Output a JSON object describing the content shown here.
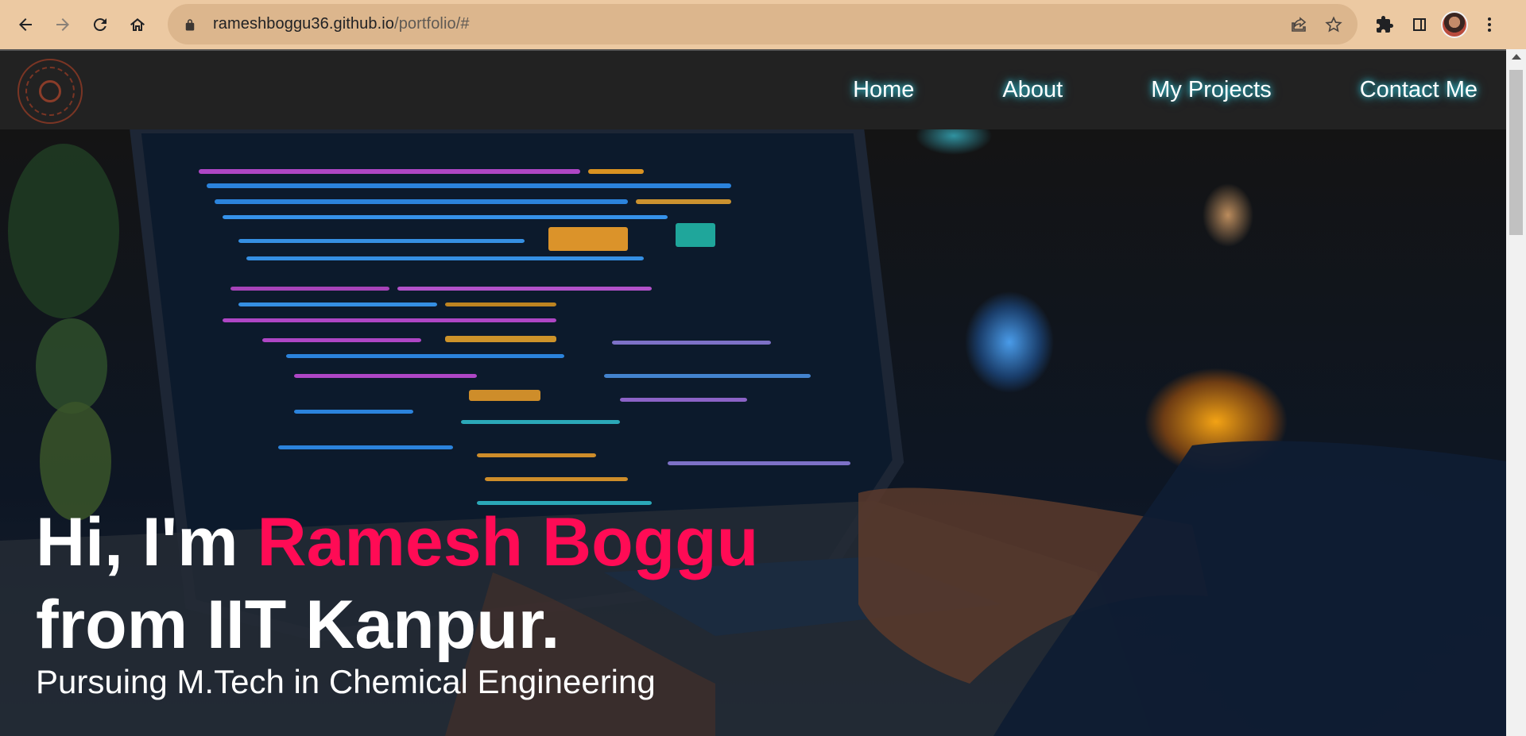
{
  "browser": {
    "url_host": "rameshboggu36.github.io",
    "url_path": "/portfolio/#"
  },
  "nav": {
    "items": [
      {
        "label": "Home"
      },
      {
        "label": "About"
      },
      {
        "label": "My Projects"
      },
      {
        "label": "Contact Me"
      }
    ]
  },
  "hero": {
    "greeting": "Hi, I'm ",
    "name": "Ramesh Boggu",
    "line2": "from IIT Kanpur.",
    "subtitle": "Pursuing M.Tech in Chemical Engineering",
    "name_color": "#ff0b55",
    "nav_glow_color": "#2fd3e8"
  },
  "icons": {
    "back": "arrow-left-icon",
    "forward": "arrow-right-icon",
    "reload": "reload-icon",
    "home": "home-icon",
    "lock": "lock-icon",
    "share": "share-icon",
    "bookmark": "star-icon",
    "extensions": "puzzle-icon",
    "sidepanel": "side-panel-icon",
    "menu": "kebab-menu-icon"
  }
}
